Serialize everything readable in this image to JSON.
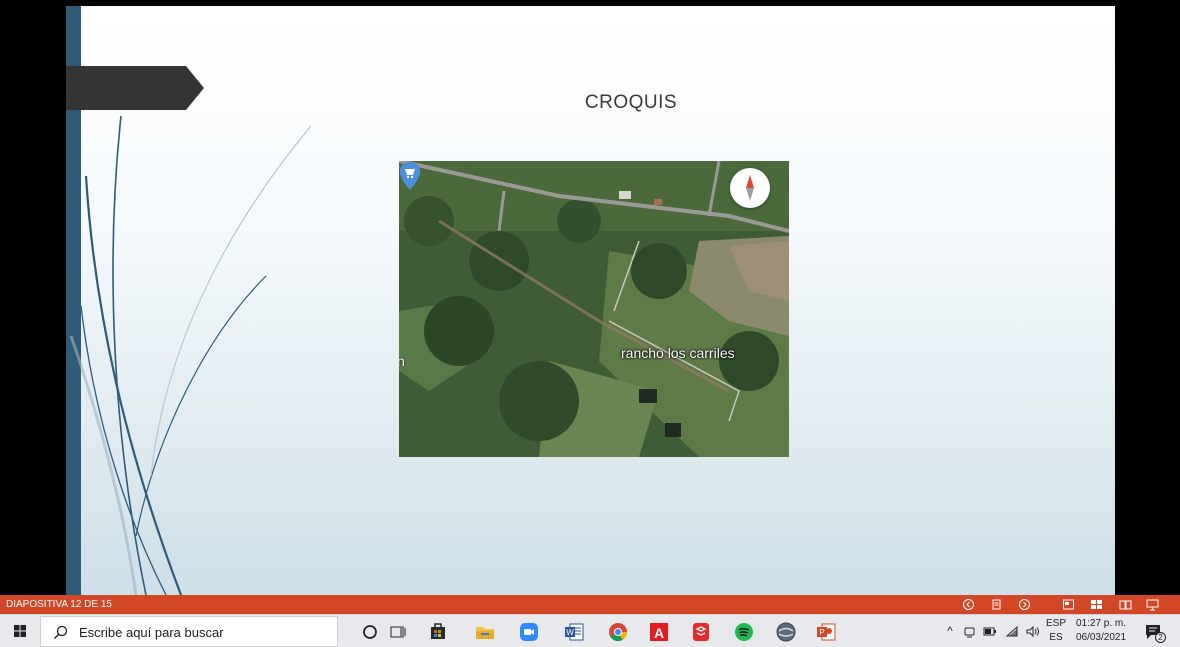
{
  "slide": {
    "title": "CROQUIS"
  },
  "map": {
    "place_label": "rancho los carriles",
    "edge_label": "n"
  },
  "statusbar": {
    "slide_count": "DIAPOSITIVA 12 DE 15"
  },
  "taskbar": {
    "search_placeholder": "Escribe aquí para buscar",
    "apps": [
      "cortana-icon",
      "task-view-icon",
      "store-icon",
      "file-explorer-icon",
      "zoom-icon",
      "word-icon",
      "chrome-icon",
      "autocad-icon",
      "sketchup-icon",
      "spotify-icon",
      "google-earth-icon",
      "powerpoint-icon"
    ]
  },
  "tray": {
    "lang_top": "ESP",
    "lang_bottom": "ES",
    "time": "01:27 p. m.",
    "date": "06/03/2021",
    "notifications": "2"
  },
  "colors": {
    "statusbar": "#d24726",
    "slide_edge": "#2e5b78",
    "taskbar": "#e7e9ec"
  }
}
